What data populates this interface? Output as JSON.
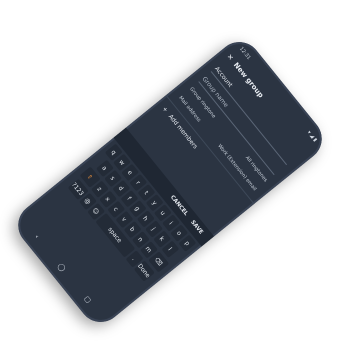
{
  "status": {
    "time": "12:31",
    "icons": "▾ ◢ ▮"
  },
  "appbar": {
    "title": "New group"
  },
  "fields": {
    "account": "Account",
    "group_name": "Group name"
  },
  "ringtone": {
    "label": "Group ringtone",
    "value": "All ringtones"
  },
  "mail": {
    "label": "Mail address",
    "value": "Work (Extension) email"
  },
  "add_members": "Add members",
  "actions": {
    "cancel": "CANCEL",
    "save": "SAVE"
  },
  "keyboard": {
    "row1": [
      "q",
      "w",
      "e",
      "r",
      "t",
      "y",
      "u",
      "i",
      "o",
      "p"
    ],
    "row2": [
      "a",
      "s",
      "d",
      "f",
      "g",
      "h",
      "j",
      "k",
      "l"
    ],
    "row3": [
      "⇧",
      "z",
      "x",
      "c",
      "v",
      "b",
      "n",
      "m",
      "⌫"
    ],
    "row4": [
      "?123",
      "@",
      "☺",
      "space",
      ".",
      "Done"
    ]
  },
  "navbar": {
    "back": "‹",
    "home": "◯",
    "recent": "▢"
  }
}
